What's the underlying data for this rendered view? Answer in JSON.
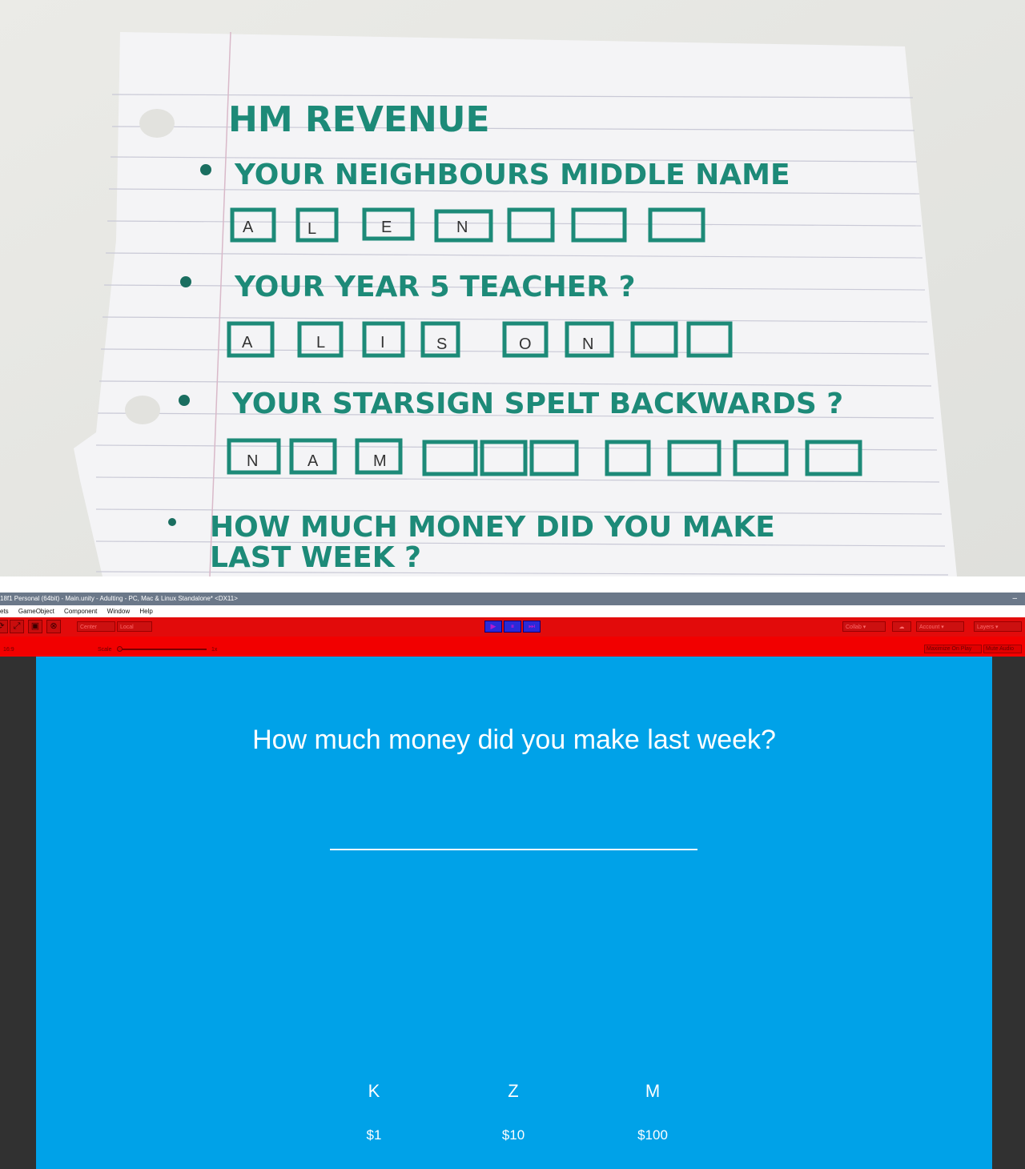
{
  "paper": {
    "title": "HM REVENUE",
    "questions": [
      {
        "text": "YOUR NEIGHBOURS MIDDLE NAME",
        "letters": [
          "A",
          "L",
          "E",
          "N"
        ]
      },
      {
        "text": "YOUR YEAR 5 TEACHER ?",
        "letters": [
          "A",
          "L",
          "I",
          "S",
          "O",
          "N"
        ]
      },
      {
        "text": "YOUR STARSIGN SPELT BACKWARDS ?",
        "letters": [
          "N",
          "A",
          "M"
        ]
      },
      {
        "text_line1": "HOW MUCH MONEY DID YOU MAKE",
        "text_line2": "LAST WEEK ?"
      }
    ]
  },
  "editor": {
    "title": "18f1 Personal (64bit) - Main.unity - Adulting - PC, Mac & Linux Standalone* <DX11>",
    "minimize_glyph": "–",
    "menu": [
      "ets",
      "GameObject",
      "Component",
      "Window",
      "Help"
    ],
    "toolbar": {
      "center": "Center",
      "local": "Local",
      "play_icon": "▶",
      "pause_icon": "⏸",
      "step_icon": "⏭",
      "collab": "Collab ▾",
      "account": "Account ▾",
      "layers": "Layers ▾"
    },
    "gamebar": {
      "aspect": "16:9",
      "scale_label": "Scale",
      "scale_value": "1x",
      "maximize": "Maximize On Play",
      "mute": "Mute Audio"
    }
  },
  "game": {
    "question": "How much money did you make last week?",
    "options": [
      {
        "key": "K",
        "value": "$1"
      },
      {
        "key": "Z",
        "value": "$10"
      },
      {
        "key": "M",
        "value": "$100"
      }
    ],
    "background": "#00a2e8"
  }
}
